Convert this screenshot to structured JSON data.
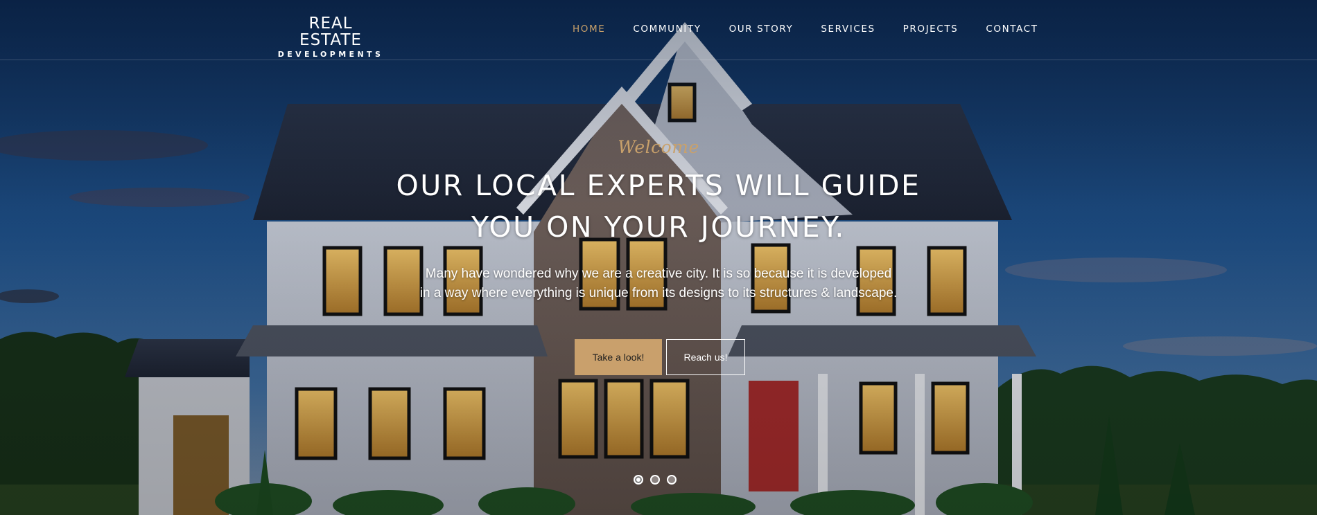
{
  "brand": {
    "title": "REAL ESTATE",
    "subtitle": "DEVELOPMENTS"
  },
  "nav": {
    "items": [
      {
        "label": "HOME",
        "active": true
      },
      {
        "label": "COMMUNITY",
        "active": false
      },
      {
        "label": "OUR STORY",
        "active": false
      },
      {
        "label": "SERVICES",
        "active": false
      },
      {
        "label": "PROJECTS",
        "active": false
      },
      {
        "label": "CONTACT",
        "active": false
      }
    ]
  },
  "hero": {
    "welcome": "Welcome",
    "headline_line1": "OUR LOCAL EXPERTS WILL GUIDE",
    "headline_line2": "YOU ON YOUR JOURNEY.",
    "sub_line1": "Many have wondered why we are a creative city. It is so because it is developed",
    "sub_line2": "in a way where everything is unique from its designs to its structures & landscape.",
    "primary_button": "Take a look!",
    "secondary_button": "Reach us!"
  },
  "slider": {
    "count": 3,
    "active_index": 0
  },
  "colors": {
    "accent": "#c9a06c",
    "nav_active": "#c8a06a",
    "text": "#ffffff"
  }
}
